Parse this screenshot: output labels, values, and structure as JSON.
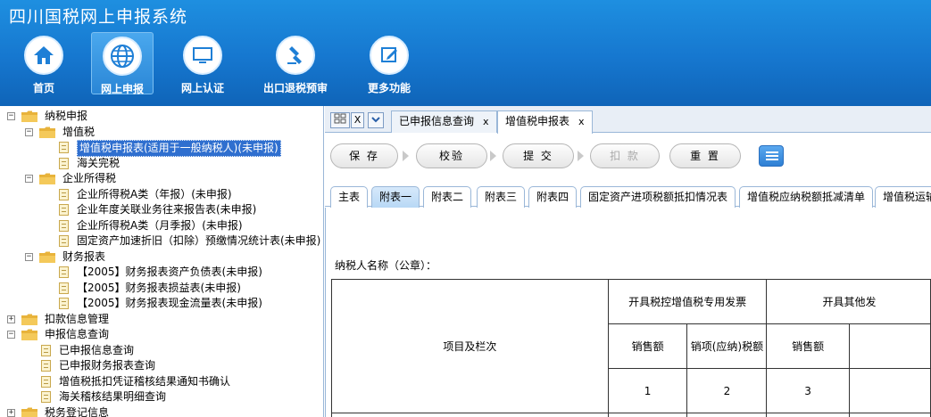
{
  "header": {
    "title": "四川国税网上申报系统",
    "nav": [
      {
        "label": "首页",
        "icon": "home-icon"
      },
      {
        "label": "网上申报",
        "icon": "globe-icon",
        "active": true
      },
      {
        "label": "网上认证",
        "icon": "monitor-icon"
      },
      {
        "label": "出口退税预审",
        "icon": "stamp-icon"
      },
      {
        "label": "更多功能",
        "icon": "edit-icon"
      }
    ]
  },
  "sidebar": {
    "nodes": [
      {
        "label": "纳税申报",
        "type": "folder",
        "toggle": "⊟"
      },
      {
        "label": "增值税",
        "type": "folder",
        "toggle": "⊟"
      },
      {
        "label": "增值税申报表(适用于一般纳税人)(未申报)",
        "type": "doc",
        "selected": true
      },
      {
        "label": "海关完税",
        "type": "doc"
      },
      {
        "label": "企业所得税",
        "type": "folder",
        "toggle": "⊟"
      },
      {
        "label": "企业所得税A类（年报）(未申报)",
        "type": "doc"
      },
      {
        "label": "企业年度关联业务往来报告表(未申报)",
        "type": "doc"
      },
      {
        "label": "企业所得税A类（月季报）(未申报)",
        "type": "doc"
      },
      {
        "label": "固定资产加速折旧（扣除）预缴情况统计表(未申报)",
        "type": "doc"
      },
      {
        "label": "财务报表",
        "type": "folder",
        "toggle": "⊟"
      },
      {
        "label": "【2005】财务报表资产负债表(未申报)",
        "type": "doc"
      },
      {
        "label": "【2005】财务报表损益表(未申报)",
        "type": "doc"
      },
      {
        "label": "【2005】财务报表现金流量表(未申报)",
        "type": "doc"
      },
      {
        "label": "扣款信息管理",
        "type": "folder",
        "toggle": "⊞"
      },
      {
        "label": "申报信息查询",
        "type": "folder",
        "toggle": "⊟"
      },
      {
        "label": "已申报信息查询",
        "type": "doc"
      },
      {
        "label": "已申报财务报表查询",
        "type": "doc"
      },
      {
        "label": "增值税抵扣凭证稽核结果通知书确认",
        "type": "doc"
      },
      {
        "label": "海关稽核结果明细查询",
        "type": "doc"
      },
      {
        "label": "税务登记信息",
        "type": "folder",
        "toggle": "⊞"
      }
    ]
  },
  "tabs": {
    "close_label": "X",
    "items": [
      {
        "label": "已申报信息查询",
        "close": "x"
      },
      {
        "label": "增值税申报表",
        "close": "x",
        "active": true
      }
    ]
  },
  "toolbar": {
    "save": "保 存",
    "verify": "校验",
    "submit": "提 交",
    "deduct": "扣 款",
    "reset": "重 置"
  },
  "subtabs": [
    "主表",
    "附表一",
    "附表二",
    "附表三",
    "附表四",
    "固定资产进项税额抵扣情况表",
    "增值税应纳税额抵减清单",
    "增值税运输"
  ],
  "form": {
    "taxpayer_label": "纳税人名称（公章）：",
    "table": {
      "row_header": "项目及栏次",
      "group1": "开具税控增值税专用发票",
      "group2": "开具其他发",
      "col_sales": "销售额",
      "col_tax": "销项(应纳)税额",
      "col_sales2": "销售额",
      "col_num": [
        "1",
        "2",
        "3"
      ]
    }
  },
  "colors": {
    "header_blue": "#1677cf",
    "selected": "#2f6fcf",
    "folder": "#e8b33b"
  }
}
